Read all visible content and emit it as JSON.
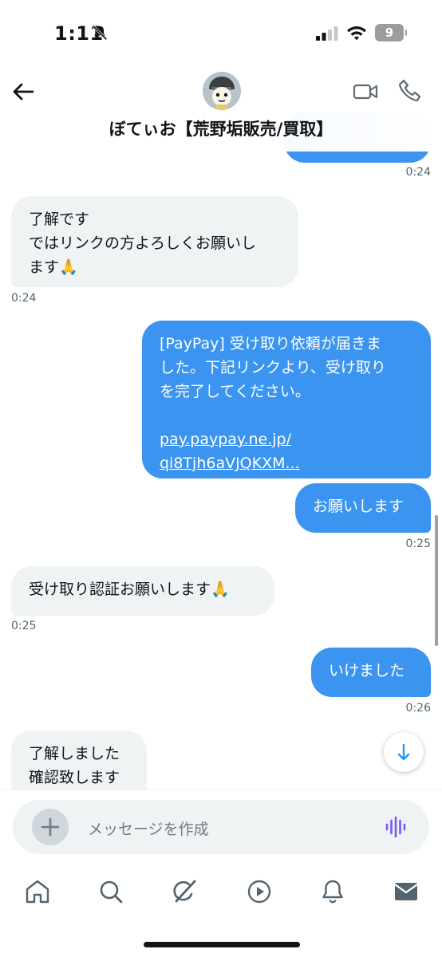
{
  "status_bar": {
    "time": "1:11",
    "battery": "9"
  },
  "header": {
    "title": "ぼてぃお【荒野垢販売/買取】"
  },
  "messages": [
    {
      "side": "out",
      "time": "0:24"
    },
    {
      "side": "in",
      "line1": "了解です",
      "line2": "ではリンクの方よろしくお願いし",
      "line3": "ます🙏",
      "time": "0:24"
    },
    {
      "side": "out",
      "line1": "[PayPay] 受け取り依頼が届きま",
      "line2": "した。下記リンクより、受け取り",
      "line3": "を完了してください。",
      "link1": "pay.paypay.ne.jp/",
      "link2": "qi8Tjh6aVJQKXM..."
    },
    {
      "side": "out",
      "text": "お願いします",
      "time": "0:25"
    },
    {
      "side": "in",
      "text": "受け取り認証お願いします🙏",
      "time": "0:25"
    },
    {
      "side": "out",
      "text": "いけました",
      "time": "0:26"
    },
    {
      "side": "in",
      "line1": "了解しました",
      "line2": "確認致します"
    }
  ],
  "composer": {
    "placeholder": "メッセージを作成"
  },
  "colors": {
    "accent": "#1d9bf0",
    "outgoing_bubble": "#3b94ef",
    "incoming_bubble": "#eff3f4",
    "voice": "#7856ff"
  },
  "nav": [
    "home-icon",
    "search-icon",
    "grok-icon",
    "video-icon",
    "notifications-icon",
    "messages-icon"
  ]
}
